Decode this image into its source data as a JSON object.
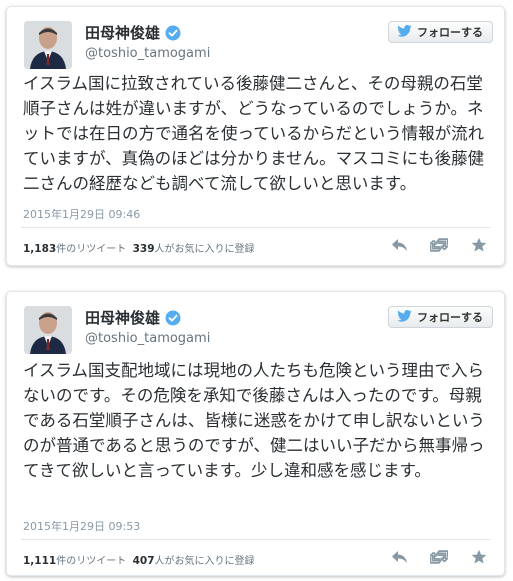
{
  "tweets": [
    {
      "display_name": "田母神俊雄",
      "handle": "@toshio_tamogami",
      "follow_label": "フォローする",
      "text": "イスラム国に拉致されている後藤健二さんと、その母親の石堂順子さんは姓が違いますが、どうなっているのでしょうか。ネットでは在日の方で通名を使っているからだという情報が流れていますが、真偽のほどは分かりません。マスコミにも後藤健二さんの経歴なども調べて流して欲しいと思います。",
      "timestamp": "2015年1月29日  09:46",
      "retweets_count": "1,183",
      "retweets_label": "件のリツイート",
      "favorites_count": "339",
      "favorites_label": "人がお気に入りに登録"
    },
    {
      "display_name": "田母神俊雄",
      "handle": "@toshio_tamogami",
      "follow_label": "フォローする",
      "text": "イスラム国支配地域には現地の人たちも危険という理由で入らないのです。その危険を承知で後藤さんは入ったのです。母親である石堂順子さんは、皆様に迷惑をかけて申し訳ないというのが普通であると思うのですが、健二はいい子だから無事帰ってきて欲しいと言っています。少し違和感を感じます。",
      "timestamp": "2015年1月29日  09:53",
      "retweets_count": "1,111",
      "retweets_label": "件のリツイート",
      "favorites_count": "407",
      "favorites_label": "人がお気に入りに登録"
    }
  ],
  "colors": {
    "verified": "#55acee",
    "twitter_bird": "#55acee",
    "action_icon": "#8899a6"
  },
  "icons": [
    "avatar",
    "verified-badge-icon",
    "twitter-bird-icon",
    "reply-icon",
    "retweet-icon",
    "favorite-star-icon"
  ]
}
